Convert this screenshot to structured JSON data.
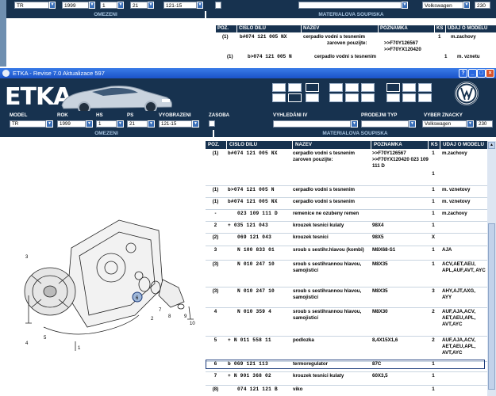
{
  "background_window": {
    "filters": {
      "model": "TR",
      "rok": "1999",
      "hs": "1",
      "ps": "21",
      "vyobrazeni": "121-15",
      "vyber_znacky": "Volkswagen",
      "page": "230"
    },
    "section_left": "OMEZENI",
    "section_right": "MATERIALOVA SOUPISKA",
    "columns": [
      "POZ.",
      "CISLO DILU",
      "NAZEV",
      "POZNAMKA",
      "KS",
      "UDAJ O MODELU"
    ],
    "rows": [
      {
        "pos": "(1)",
        "part": "b#074 121 005 NX",
        "name": "cerpadlo vodni s tesnenim",
        "name2": "zaroven pouzijte:",
        "note": ">>F70Y126567",
        "note2": ">>F70YX120420",
        "qty": "1",
        "model": "m.zachovy"
      },
      {
        "pos": "(1)",
        "part": "b>074 121 005 N",
        "name": "cerpadlo vodni s tesnenim",
        "qty": "1",
        "model": "m. vznetu"
      }
    ]
  },
  "window": {
    "title": "ETKA - Revise 7.0 Aktualizace 597",
    "buttons": [
      "?",
      "_",
      "□",
      "×"
    ]
  },
  "header": {
    "logo": "ETKA"
  },
  "filters": {
    "labels": {
      "model": "MODEL",
      "rok": "ROK",
      "hs": "HS",
      "ps": "PS",
      "vyobrazeni": "VYOBRAZENI",
      "zasoba": "ZASOBA",
      "vyhledani": "VYHLEDÁNI IV",
      "prodejni_typ": "PRODEJNI TYP",
      "vyber_znacky": "VYBER ZNACKY"
    },
    "values": {
      "model": "TR",
      "rok": "1999",
      "hs": "1",
      "ps": "21",
      "vyobrazeni": "121-15",
      "vyhledani": "",
      "prodejni_typ": "",
      "vyber_znacky": "Volkswagen",
      "page": "230"
    }
  },
  "sections": {
    "left": "OMEZENI",
    "right": "MATERIALOVA SOUPISKA"
  },
  "table": {
    "columns": [
      "POZ.",
      "CISLO DILU",
      "NAZEV",
      "POZNAMKA",
      "KS",
      "UDAJ O MODELU"
    ],
    "rows": [
      {
        "pos": "(1)",
        "part": "b#074 121 005 NX",
        "name": "cerpadlo vodni s tesnenim zaroven pouzijte:",
        "note": ">>F70Y126567 >>F70YX120420 023 109 111 D",
        "qty": "1",
        "qty2": "1",
        "model": "m.zachovy"
      },
      {
        "pos": "(1)",
        "part": "b>074 121 005 N",
        "name": "cerpadlo vodni s tesnenim",
        "note": "",
        "qty": "1",
        "model": "m. vznetovy"
      },
      {
        "pos": "(1)",
        "part": "b#074 121 005 NX",
        "name": "cerpadlo vodni s tesnenim",
        "note": "",
        "qty": "1",
        "model": "m. vznetovy"
      },
      {
        "pos": "-",
        "part": "023 109 111 D",
        "name": "remenice ne ozubeny remen",
        "note": "",
        "qty": "1",
        "model": "m.zachovy"
      },
      {
        "pos": "2",
        "part": "+ 035 121 043",
        "name": "krouzek tesnici kulaty",
        "note": "98X4",
        "qty": "1",
        "model": ""
      },
      {
        "pos": "(2)",
        "part": "069 121 043",
        "name": "krouzek tesnici",
        "note": "98X5",
        "qty": "X",
        "model": ""
      },
      {
        "pos": "3",
        "part": "N 100 833 01",
        "name": "sroub s sestihr.hlavou (kombi)",
        "note": "M8X68-S1",
        "qty": "1",
        "model": "AJA"
      },
      {
        "pos": "(3)",
        "part": "N 010 247 10",
        "name": "sroub s sestihrannou hlavou, samojisticí",
        "note": "M8X35",
        "qty": "1",
        "model": "ACV,AET,AEU, APL,AUF,AVT, AYC"
      },
      {
        "pos": "(3)",
        "part": "N 010 247 10",
        "name": "sroub s sestihrannou hlavou, samojisticí",
        "note": "M8X35",
        "qty": "3",
        "model": "AHY,AJT,AXG, AYY"
      },
      {
        "pos": "4",
        "part": "N 010 359 4",
        "name": "sroub s sestihrannou hlavou, samojisticí",
        "note": "M8X30",
        "qty": "2",
        "model": "AUF,AJA,ACV, AET,AEU,APL, AVT,AYC"
      },
      {
        "pos": "5",
        "part": "+ N 011 558 11",
        "name": "podlozka",
        "note": "8,4X15X1,6",
        "qty": "2",
        "model": "AUF,AJA,ACV, AET,AEU,APL, AVT,AYC"
      },
      {
        "pos": "6",
        "part": "b 069 121 113",
        "name": "termoregulator",
        "note": "87C",
        "qty": "1",
        "model": ""
      },
      {
        "pos": "7",
        "part": "+ N 901 368 02",
        "name": "krouzek tesnici kulaty",
        "note": "60X3,5",
        "qty": "1",
        "model": ""
      },
      {
        "pos": "(8)",
        "part": "074 121 121 B",
        "name": "viko",
        "note": "",
        "qty": "1",
        "model": ""
      }
    ]
  },
  "diagram": {
    "callouts": [
      "1",
      "2",
      "3",
      "4",
      "5",
      "6",
      "7",
      "8",
      "9",
      "10"
    ]
  }
}
